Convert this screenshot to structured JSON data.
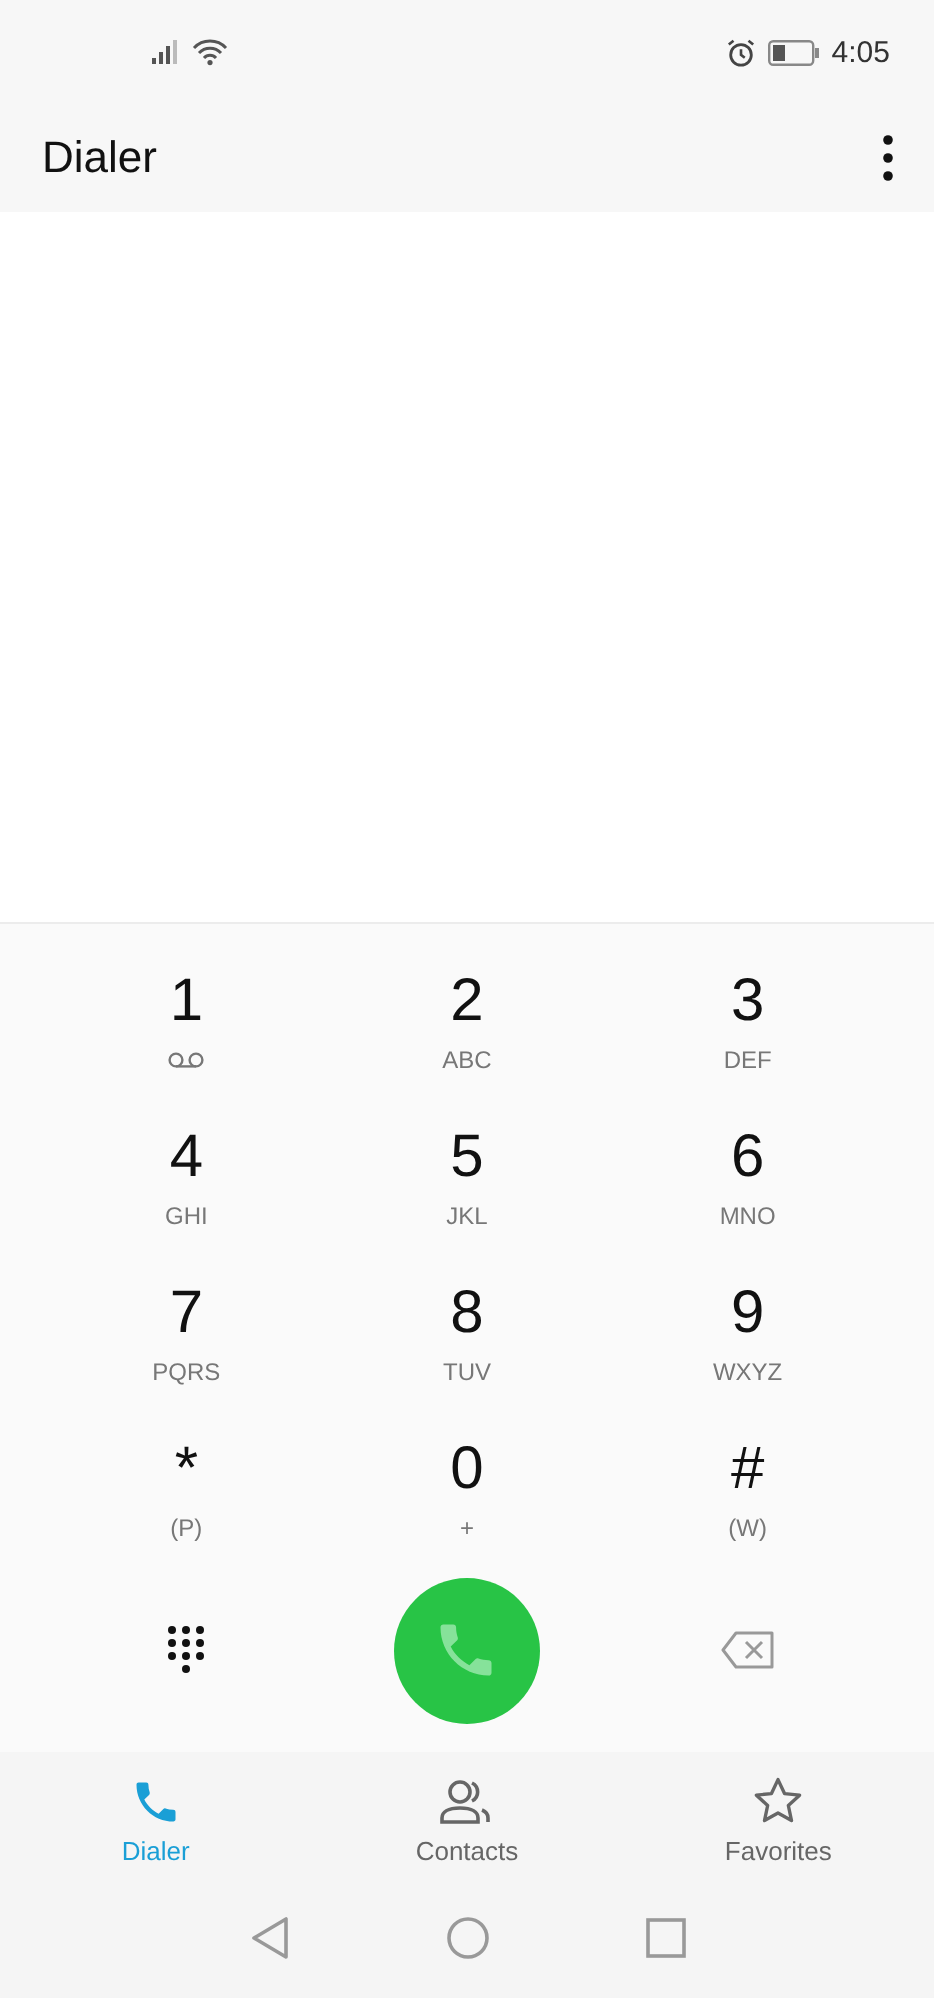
{
  "status_bar": {
    "time": "4:05"
  },
  "header": {
    "title": "Dialer"
  },
  "keypad": [
    {
      "digit": "1",
      "kind": "voicemail"
    },
    {
      "digit": "2",
      "kind": "letters",
      "letters": "ABC"
    },
    {
      "digit": "3",
      "kind": "letters",
      "letters": "DEF"
    },
    {
      "digit": "4",
      "kind": "letters",
      "letters": "GHI"
    },
    {
      "digit": "5",
      "kind": "letters",
      "letters": "JKL"
    },
    {
      "digit": "6",
      "kind": "letters",
      "letters": "MNO"
    },
    {
      "digit": "7",
      "kind": "letters",
      "letters": "PQRS"
    },
    {
      "digit": "8",
      "kind": "letters",
      "letters": "TUV"
    },
    {
      "digit": "9",
      "kind": "letters",
      "letters": "WXYZ"
    },
    {
      "digit": "*",
      "kind": "letters",
      "letters": "(P)"
    },
    {
      "digit": "0",
      "kind": "letters",
      "letters": "+"
    },
    {
      "digit": "#",
      "kind": "letters",
      "letters": "(W)"
    }
  ],
  "tabs": [
    {
      "label": "Dialer",
      "kind": "phone",
      "selected": true
    },
    {
      "label": "Contacts",
      "kind": "contacts",
      "selected": false
    },
    {
      "label": "Favorites",
      "kind": "star",
      "selected": false
    }
  ]
}
